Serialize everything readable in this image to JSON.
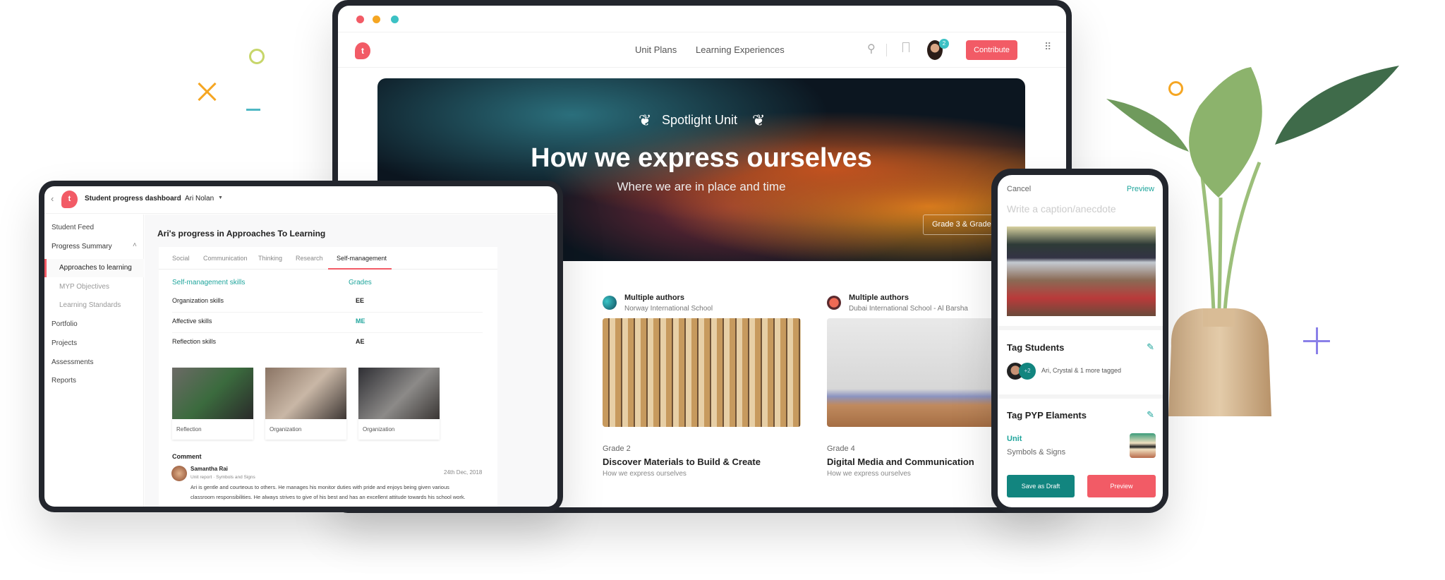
{
  "colors": {
    "brand_red": "#f25b66",
    "teal": "#1fa59c",
    "dark_teal": "#12857f",
    "decor_orange": "#f5a623",
    "decor_green": "#c7d66a",
    "decor_teal": "#4fb8c4",
    "decor_purple": "#8a80e8"
  },
  "browser": {
    "nav": {
      "links": [
        "Unit Plans",
        "Learning Experiences"
      ],
      "notification_count": "2",
      "contribute_label": "Contribute"
    },
    "hero": {
      "badge": "Spotlight Unit",
      "title": "How we express ourselves",
      "subtitle": "Where we are in place and time",
      "grade_button": "Grade 3 & Grade 4"
    },
    "cards": [
      {
        "author": "Multiple authors",
        "school": "Norway International School",
        "grade": "Grade 2",
        "title": "Discover Materials to Build & Create",
        "theme": "How we express ourselves"
      },
      {
        "author": "Multiple authors",
        "school": "Dubai International School - Al Barsha",
        "grade": "Grade 4",
        "title": "Digital Media and Communication",
        "theme": "How we express ourselves"
      }
    ]
  },
  "tablet": {
    "breadcrumb": {
      "page": "Student progress dashboard",
      "student": "Ari Nolan"
    },
    "sidebar": {
      "items": [
        "Student Feed",
        "Progress Summary",
        "Approaches to learning",
        "MYP Objectives",
        "Learning Standards",
        "Portfolio",
        "Projects",
        "Assessments",
        "Reports"
      ]
    },
    "title": "Ari's progress in Approaches To Learning",
    "tabs": [
      "Social",
      "Communication",
      "Thinking",
      "Research",
      "Self-management"
    ],
    "active_tab": "Self-management",
    "table": {
      "headers": [
        "Self-management skills",
        "Grades"
      ],
      "rows": [
        [
          "Organization skills",
          "EE"
        ],
        [
          "Affective skills",
          "ME"
        ],
        [
          "Reflection skills",
          "AE"
        ]
      ]
    },
    "evidence": [
      "Reflection",
      "Organization",
      "Organization"
    ],
    "comment": {
      "label": "Comment",
      "author": "Samantha Rai",
      "context": "Unit report · Symbols and Signs",
      "date": "24th Dec, 2018",
      "lines": [
        "Ari is gentle and courteous to others. He manages his monitor duties with pride and enjoys being given various",
        "classroom responsibilities. He always strives to give of his best and has an excellent attitude towards his school work."
      ]
    }
  },
  "phone": {
    "cancel": "Cancel",
    "preview_link": "Preview",
    "caption_placeholder": "Write a caption/anecdote",
    "tag_students": {
      "title": "Tag Students",
      "extra_count": "+2",
      "summary": "Ari, Crystal & 1 more tagged"
    },
    "tag_pyp": {
      "title": "Tag PYP Elaments",
      "label": "Unit",
      "value": "Symbols & Signs"
    },
    "save_draft": "Save as Draft",
    "preview_button": "Preview"
  }
}
